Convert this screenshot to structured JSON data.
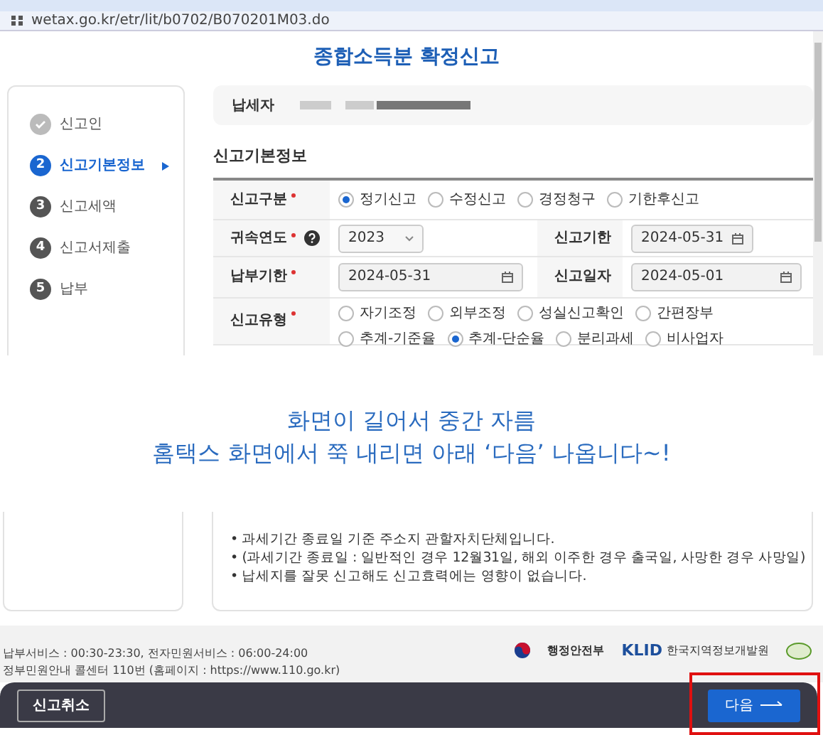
{
  "window": {
    "address": "wetax.go.kr/etr/lit/b0702/B070201M03.do"
  },
  "page_title": "종합소득분 확정신고",
  "steps": [
    {
      "kind": "done",
      "label": "신고인",
      "selected": false
    },
    {
      "kind": "number",
      "number": "2",
      "label": "신고기본정보",
      "selected": true
    },
    {
      "kind": "number",
      "number": "3",
      "label": "신고세액",
      "selected": false
    },
    {
      "kind": "number",
      "number": "4",
      "label": "신고서제출",
      "selected": false
    },
    {
      "kind": "number",
      "number": "5",
      "label": "납부",
      "selected": false
    }
  ],
  "taxpayer": {
    "label": "납세자"
  },
  "section_title": "신고기본정보",
  "form_rows": [
    {
      "cells": [
        {
          "kind": "label",
          "text": "신고구분",
          "required": true
        },
        {
          "kind": "radios",
          "options": [
            {
              "label": "정기신고",
              "selected": true
            },
            {
              "label": "수정신고",
              "selected": false
            },
            {
              "label": "경정청구",
              "selected": false
            },
            {
              "label": "기한후신고",
              "selected": false
            }
          ]
        }
      ]
    },
    {
      "cells": [
        {
          "kind": "label",
          "text": "귀속연도",
          "required": true,
          "help": true
        },
        {
          "kind": "select",
          "value": "2023"
        },
        {
          "kind": "label",
          "text": "신고기한",
          "required": false
        },
        {
          "kind": "date",
          "value": "2024-05-31"
        }
      ]
    },
    {
      "cells": [
        {
          "kind": "label",
          "text": "납부기한",
          "required": true
        },
        {
          "kind": "date",
          "value": "2024-05-31"
        },
        {
          "kind": "label",
          "text": "신고일자",
          "required": false
        },
        {
          "kind": "date",
          "value": "2024-05-01"
        }
      ]
    },
    {
      "cells": [
        {
          "kind": "label",
          "text": "신고유형",
          "required": true
        },
        {
          "kind": "radios",
          "options": [
            {
              "label": "자기조정",
              "selected": false
            },
            {
              "label": "외부조정",
              "selected": false
            },
            {
              "label": "성실신고확인",
              "selected": false
            },
            {
              "label": "간편장부",
              "selected": false
            },
            {
              "label": "추계-기준율",
              "selected": false
            },
            {
              "label": "추계-단순율",
              "selected": true
            },
            {
              "label": "분리과세",
              "selected": false
            },
            {
              "label": "비사업자",
              "selected": false
            }
          ]
        }
      ]
    }
  ],
  "annotation": [
    "화면이 길어서 중간 자름",
    "홈택스 화면에서 쭉 내리면 아래 ‘다음’ 나옵니다~!"
  ],
  "notes": [
    "• 과세기간 종료일 기준 주소지 관할자치단체입니다.",
    "• (과세기간 종료일 : 일반적인 경우 12월31일, 해외 이주한 경우 출국일, 사망한 경우 사망일)",
    "• 납세지를 잘못 신고해도 신고효력에는 영향이 없습니다."
  ],
  "footer": {
    "lines": [
      "납부서비스 : 00:30-23:30, 전자민원서비스 : 06:00-24:00",
      "정부민원안내 콜센터 110번 (홈페이지 : https://www.110.go.kr)"
    ],
    "ministry": "행정안전부",
    "klid_mark": "KLID",
    "klid_name": "한국지역정보개발원"
  },
  "buttons": {
    "cancel": "신고취소",
    "next": "다음"
  }
}
